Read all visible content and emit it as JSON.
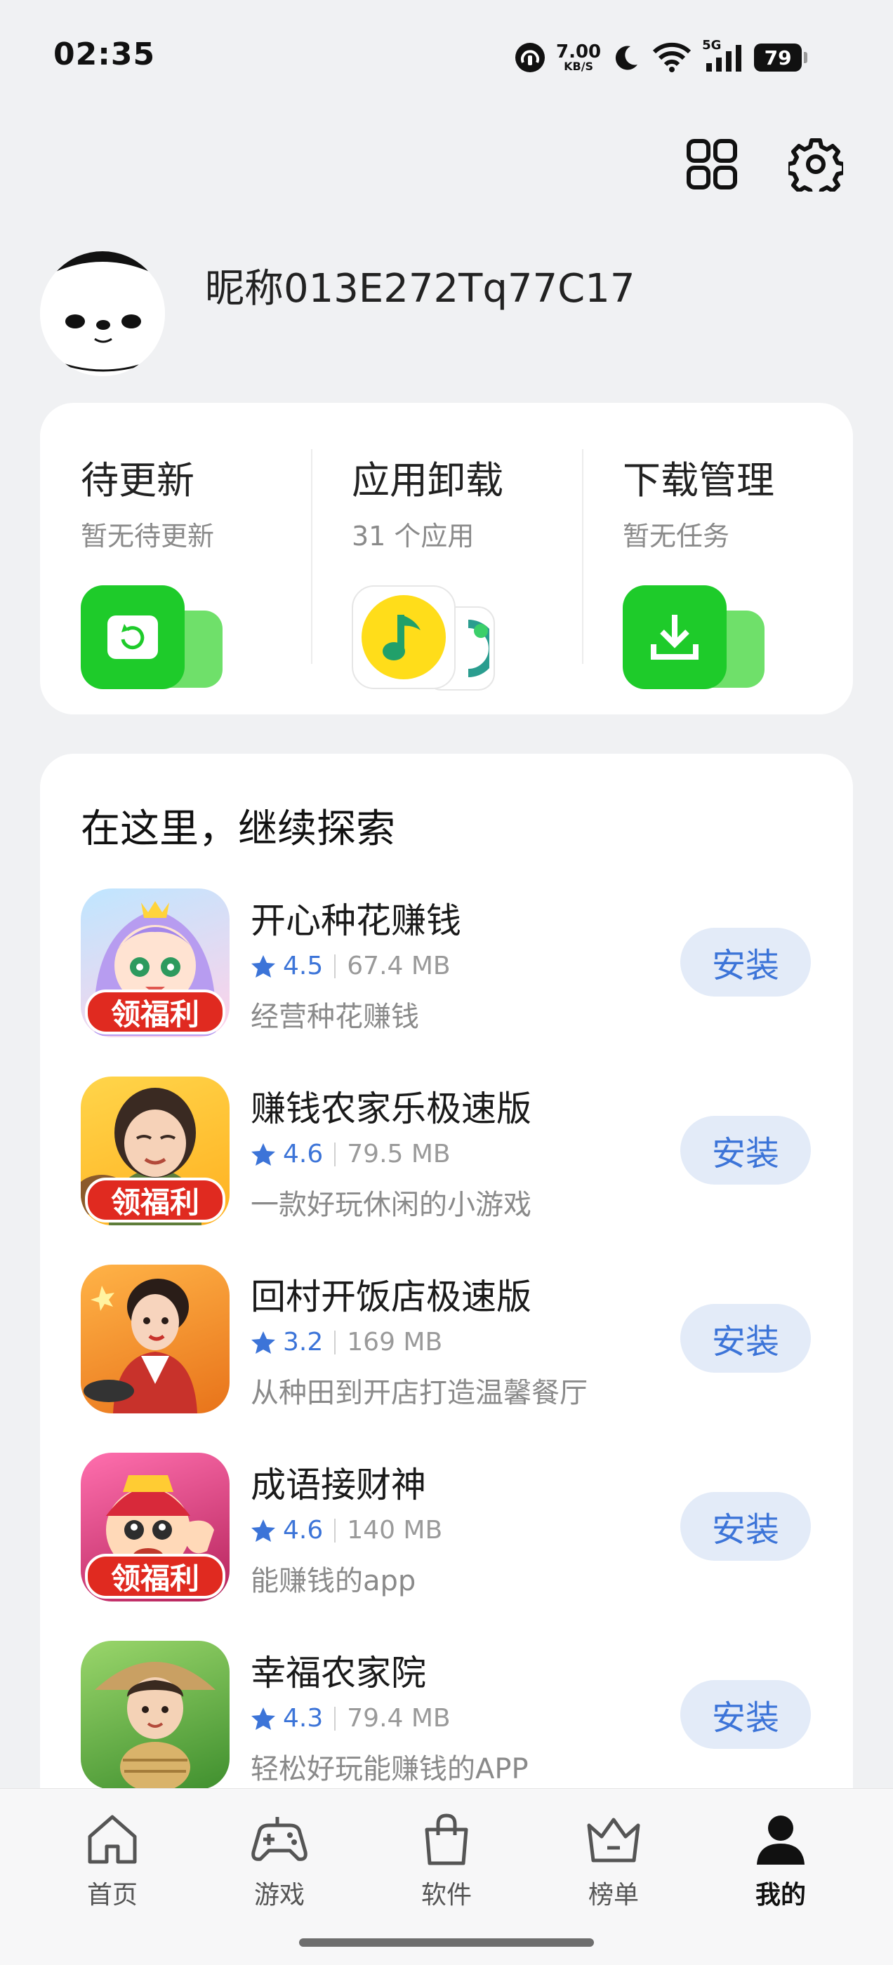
{
  "status_bar": {
    "time": "02:35",
    "net_speed_value": "7.00",
    "net_speed_unit": "KB/S",
    "signal_label": "5G",
    "battery": "79"
  },
  "profile": {
    "nickname": "昵称013E272Tq77C17"
  },
  "quick_actions": [
    {
      "title": "待更新",
      "subtitle": "暂无待更新"
    },
    {
      "title": "应用卸载",
      "subtitle": "31 个应用"
    },
    {
      "title": "下载管理",
      "subtitle": "暂无任务"
    }
  ],
  "explore": {
    "title": "在这里，继续探索",
    "install_label": "安装",
    "badge_label": "领福利",
    "apps": [
      {
        "name": "开心种花赚钱",
        "rating": "4.5",
        "size": "67.4 MB",
        "desc": "经营种花赚钱",
        "badge": true
      },
      {
        "name": "赚钱农家乐极速版",
        "rating": "4.6",
        "size": "79.5 MB",
        "desc": "一款好玩休闲的小游戏",
        "badge": true
      },
      {
        "name": "回村开饭店极速版",
        "rating": "3.2",
        "size": "169 MB",
        "desc": "从种田到开店打造温馨餐厅",
        "badge": false
      },
      {
        "name": "成语接财神",
        "rating": "4.6",
        "size": "140 MB",
        "desc": "能赚钱的app",
        "badge": true
      },
      {
        "name": "幸福农家院",
        "rating": "4.3",
        "size": "79.4 MB",
        "desc": "轻松好玩能赚钱的APP",
        "badge": false
      }
    ]
  },
  "bottom_nav": [
    {
      "label": "首页",
      "icon": "home-icon",
      "active": false
    },
    {
      "label": "游戏",
      "icon": "gamepad-icon",
      "active": false
    },
    {
      "label": "软件",
      "icon": "shopping-bag-icon",
      "active": false
    },
    {
      "label": "榜单",
      "icon": "crown-icon",
      "active": false
    },
    {
      "label": "我的",
      "icon": "person-icon",
      "active": true
    }
  ],
  "colors": {
    "accent": "#3c74d8",
    "green": "#1ecb2a",
    "badge_red": "#e02a20",
    "background": "#f0f1f3"
  }
}
